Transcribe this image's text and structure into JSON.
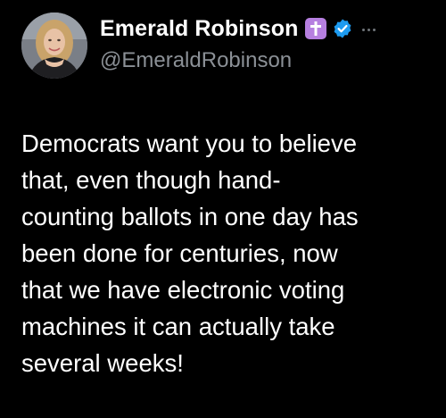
{
  "author": {
    "display_name": "Emerald Robinson",
    "handle": "@EmeraldRobinson",
    "badges": [
      "cross-emoji-icon",
      "verified-icon"
    ],
    "more_icon": "more-dots-icon"
  },
  "tweet": {
    "lines": [
      "Democrats want you to believe",
      "that, even though hand-",
      "counting ballots in one day has",
      "been done for centuries, now",
      "that we have electronic voting",
      "machines it can actually take",
      "several weeks!"
    ]
  },
  "colors": {
    "background": "#000000",
    "text": "#ffffff",
    "handle": "#8b9096",
    "verified_blue": "#1d9bf0",
    "cross_badge_purple": "#b67fe0"
  }
}
